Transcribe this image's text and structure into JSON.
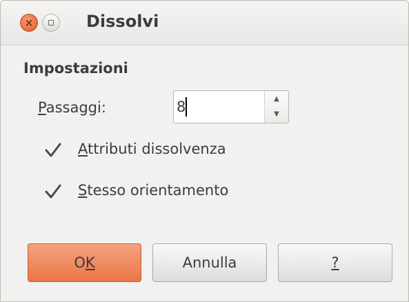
{
  "window": {
    "title": "Dissolvi",
    "close_glyph": "×"
  },
  "section": {
    "heading": "Impostazioni"
  },
  "steps": {
    "label_mnemonic": "P",
    "label_rest": "assaggi:",
    "value": "8",
    "up_glyph": "▲",
    "down_glyph": "▼"
  },
  "checkboxes": [
    {
      "mnemonic": "A",
      "rest": "ttributi dissolvenza",
      "checked": true
    },
    {
      "mnemonic": "S",
      "rest": "tesso orientamento",
      "checked": true
    }
  ],
  "buttons": {
    "ok_pre": "O",
    "ok_mnemonic": "K",
    "cancel": "Annulla",
    "help_mnemonic": "?"
  },
  "colors": {
    "accent": "#ea7649",
    "background": "#f2f1f0",
    "text": "#3c3c3c"
  }
}
